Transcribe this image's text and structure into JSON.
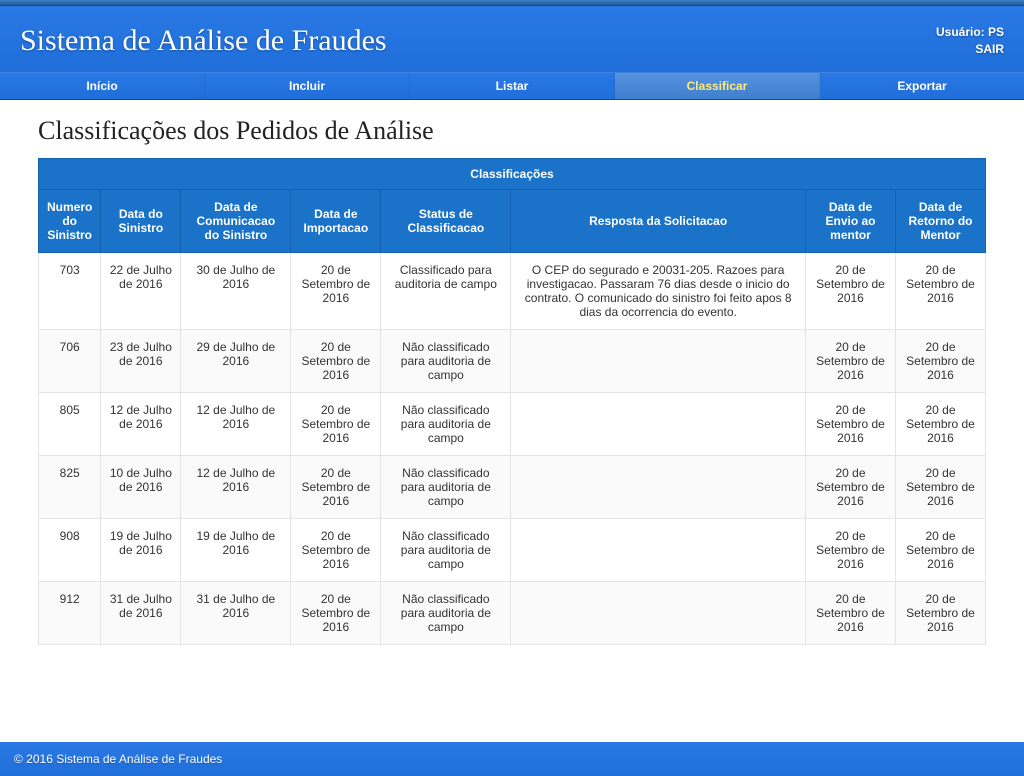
{
  "header": {
    "title": "Sistema de Análise de Fraudes",
    "user_label": "Usuário: PS",
    "logout_label": "SAIR"
  },
  "nav": {
    "items": [
      {
        "label": "Início",
        "active": false
      },
      {
        "label": "Incluir",
        "active": false
      },
      {
        "label": "Listar",
        "active": false
      },
      {
        "label": "Classificar",
        "active": true
      },
      {
        "label": "Exportar",
        "active": false
      }
    ]
  },
  "page": {
    "heading": "Classificações dos Pedidos de Análise",
    "table_caption": "Classificações",
    "columns": [
      "Numero do Sinistro",
      "Data do Sinistro",
      "Data de Comunicacao do Sinistro",
      "Data de Importacao",
      "Status de Classificacao",
      "Resposta da Solicitacao",
      "Data de Envio ao mentor",
      "Data de Retorno do Mentor"
    ],
    "rows": [
      {
        "numero": "703",
        "data_sinistro": "22 de Julho de 2016",
        "data_comunicacao": "30 de Julho de 2016",
        "data_importacao": "20 de Setembro de 2016",
        "status": "Classificado para auditoria de campo",
        "resposta": "O CEP do segurado e 20031-205. Razoes para investigacao. Passaram 76 dias desde o inicio do contrato. O comunicado do sinistro foi feito apos 8 dias da ocorrencia do evento.",
        "data_envio": "20 de Setembro de 2016",
        "data_retorno": "20 de Setembro de 2016"
      },
      {
        "numero": "706",
        "data_sinistro": "23 de Julho de 2016",
        "data_comunicacao": "29 de Julho de 2016",
        "data_importacao": "20 de Setembro de 2016",
        "status": "Não classificado para auditoria de campo",
        "resposta": "",
        "data_envio": "20 de Setembro de 2016",
        "data_retorno": "20 de Setembro de 2016"
      },
      {
        "numero": "805",
        "data_sinistro": "12 de Julho de 2016",
        "data_comunicacao": "12 de Julho de 2016",
        "data_importacao": "20 de Setembro de 2016",
        "status": "Não classificado para auditoria de campo",
        "resposta": "",
        "data_envio": "20 de Setembro de 2016",
        "data_retorno": "20 de Setembro de 2016"
      },
      {
        "numero": "825",
        "data_sinistro": "10 de Julho de 2016",
        "data_comunicacao": "12 de Julho de 2016",
        "data_importacao": "20 de Setembro de 2016",
        "status": "Não classificado para auditoria de campo",
        "resposta": "",
        "data_envio": "20 de Setembro de 2016",
        "data_retorno": "20 de Setembro de 2016"
      },
      {
        "numero": "908",
        "data_sinistro": "19 de Julho de 2016",
        "data_comunicacao": "19 de Julho de 2016",
        "data_importacao": "20 de Setembro de 2016",
        "status": "Não classificado para auditoria de campo",
        "resposta": "",
        "data_envio": "20 de Setembro de 2016",
        "data_retorno": "20 de Setembro de 2016"
      },
      {
        "numero": "912",
        "data_sinistro": "31 de Julho de 2016",
        "data_comunicacao": "31 de Julho de 2016",
        "data_importacao": "20 de Setembro de 2016",
        "status": "Não classificado para auditoria de campo",
        "resposta": "",
        "data_envio": "20 de Setembro de 2016",
        "data_retorno": "20 de Setembro de 2016"
      }
    ]
  },
  "footer": {
    "text": "© 2016 Sistema de Análise de Fraudes"
  }
}
